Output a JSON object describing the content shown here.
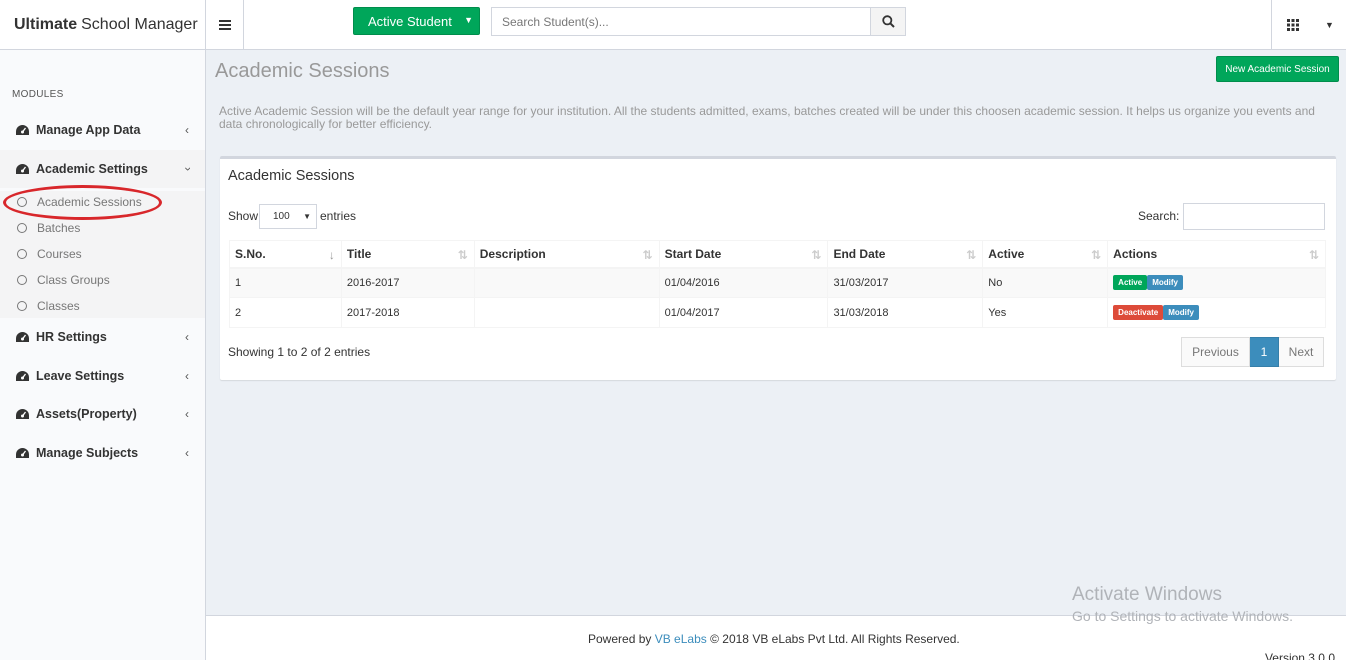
{
  "app": {
    "brand_bold": "Ultimate",
    "brand_rest": "School Manager"
  },
  "header": {
    "active_student_label": "Active Student",
    "search_placeholder": "Search Student(s)..."
  },
  "sidebar": {
    "modules_header": "MODULES",
    "items": [
      {
        "label": "Manage App Data",
        "icon": "dashboard-icon"
      },
      {
        "label": "Academic Settings",
        "icon": "dashboard-icon",
        "expanded": true
      },
      {
        "label": "HR Settings",
        "icon": "dashboard-icon"
      },
      {
        "label": "Leave Settings",
        "icon": "dashboard-icon"
      },
      {
        "label": "Assets(Property)",
        "icon": "dashboard-icon"
      },
      {
        "label": "Manage Subjects",
        "icon": "dashboard-icon"
      }
    ],
    "academic_sub": [
      {
        "label": "Academic Sessions",
        "active": true
      },
      {
        "label": "Batches"
      },
      {
        "label": "Courses"
      },
      {
        "label": "Class Groups"
      },
      {
        "label": "Classes"
      }
    ]
  },
  "page": {
    "title": "Academic Sessions",
    "new_button": "New Academic Session",
    "description": "Active Academic Session will be the default year range for your institution. All the students admitted, exams, batches created will be under this choosen academic session. It helps us organize you events and data chronologically for better efficiency."
  },
  "box": {
    "title": "Academic Sessions",
    "show_label": "Show",
    "entries_value": "100",
    "entries_label": "entries",
    "search_label": "Search:",
    "columns": [
      "S.No.",
      "Title",
      "Description",
      "Start Date",
      "End Date",
      "Active",
      "Actions"
    ],
    "rows": [
      {
        "sno": "1",
        "title": "2016-2017",
        "description": "",
        "start": "01/04/2016",
        "end": "31/03/2017",
        "active": "No",
        "action1": "Active",
        "action2": "Modify"
      },
      {
        "sno": "2",
        "title": "2017-2018",
        "description": "",
        "start": "01/04/2017",
        "end": "31/03/2018",
        "active": "Yes",
        "action1": "Deactivate",
        "action2": "Modify"
      }
    ],
    "showing": "Showing 1 to 2 of 2 entries",
    "pagination": {
      "prev": "Previous",
      "current": "1",
      "next": "Next"
    }
  },
  "footer": {
    "powered": "Powered by",
    "vb": "VB eLabs",
    "rest": "© 2018 VB eLabs Pvt Ltd. All Rights Reserved.",
    "version": "Version 3.0.0"
  },
  "watermark": {
    "line1": "Activate Windows",
    "line2": "Go to Settings to activate Windows."
  },
  "colors": {
    "green": "#00a65a",
    "blue": "#3c8dbc",
    "red": "#dd4b39",
    "annotation_red": "#d8272b"
  }
}
